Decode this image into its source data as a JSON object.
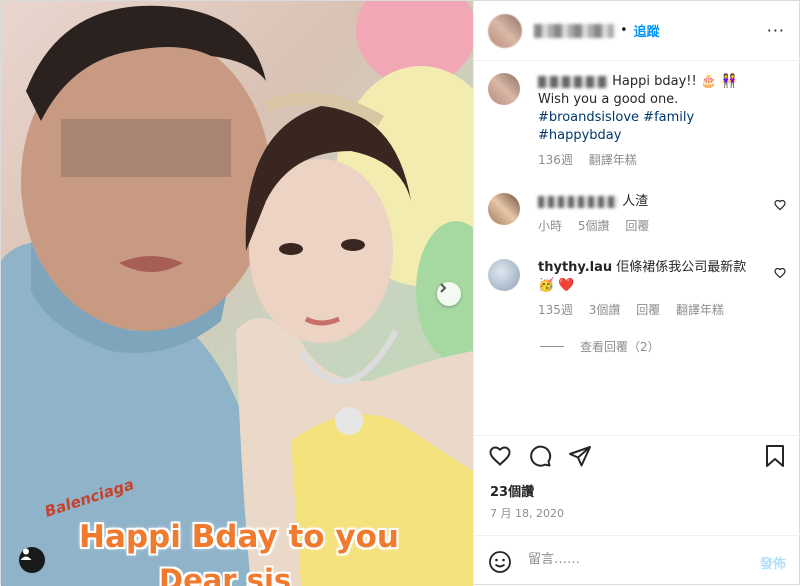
{
  "post": {
    "follow_label": "追蹤",
    "dot": "•",
    "more": "···"
  },
  "caption": {
    "text": "Happi bday!! 🎂 👭",
    "line2": "Wish you a good one.",
    "hashtags": [
      "#broandsislove",
      "#family",
      "#happybday"
    ],
    "meta": {
      "age": "136週",
      "translate": "翻譯年糕"
    }
  },
  "comments": [
    {
      "text": "人渣",
      "meta": {
        "age": "小時",
        "likes": "5個讚",
        "reply": "回覆"
      }
    },
    {
      "username": "thythy.lau",
      "text": "佢條裙係我公司最新款",
      "emoji": "🥳 ❤️",
      "meta": {
        "age": "135週",
        "likes": "3個讚",
        "reply": "回覆",
        "translate": "翻譯年糕"
      }
    }
  ],
  "view_replies": "查看回覆（2）",
  "likes_count": "23個讚",
  "date": "7 月 18, 2020",
  "composer": {
    "placeholder": "留言……",
    "post_label": "發佈"
  },
  "photo": {
    "overlay_line1": "Happi Bday to you",
    "overlay_line2": "Dear sis",
    "shirt_brand": "Balenciaga"
  },
  "colors": {
    "link": "#0095f6",
    "hashtag": "#00376b",
    "muted": "#8e8e8e",
    "overlay": "#f07a2e"
  }
}
